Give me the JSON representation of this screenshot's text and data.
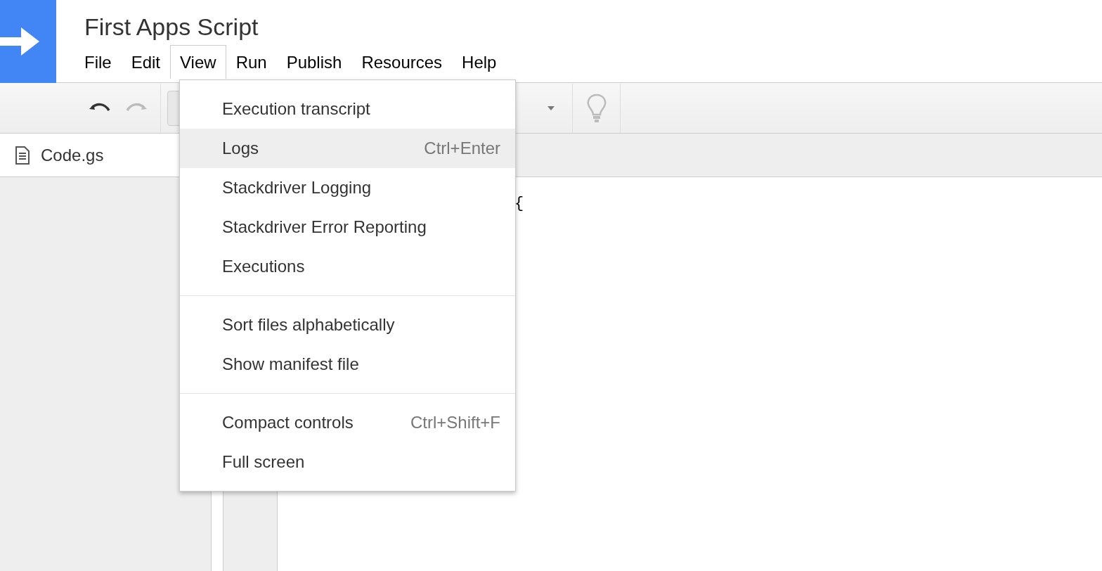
{
  "app": {
    "title": "First Apps Script"
  },
  "menu_bar": [
    {
      "label": "File",
      "selected": false
    },
    {
      "label": "Edit",
      "selected": false
    },
    {
      "label": "View",
      "selected": true
    },
    {
      "label": "Run",
      "selected": false
    },
    {
      "label": "Publish",
      "selected": false
    },
    {
      "label": "Resources",
      "selected": false
    },
    {
      "label": "Help",
      "selected": false
    }
  ],
  "file_tabs": [
    {
      "label": "Code.gs",
      "selected": true
    }
  ],
  "code_lines": [
    "{"
  ],
  "dropdown_menu": {
    "groups": [
      [
        {
          "label": "Execution transcript",
          "selected": false
        },
        {
          "label": "Logs",
          "shortcut": "Ctrl+Enter",
          "selected": true
        },
        {
          "label": "Stackdriver Logging",
          "selected": false
        },
        {
          "label": "Stackdriver Error Reporting",
          "selected": false
        },
        {
          "label": "Executions",
          "selected": false
        }
      ],
      [
        {
          "label": "Sort files alphabetically",
          "selected": false
        },
        {
          "label": "Show manifest file",
          "selected": false
        }
      ],
      [
        {
          "label": "Compact controls",
          "shortcut": "Ctrl+Shift+F",
          "selected": false
        },
        {
          "label": "Full screen",
          "selected": false
        }
      ]
    ]
  }
}
